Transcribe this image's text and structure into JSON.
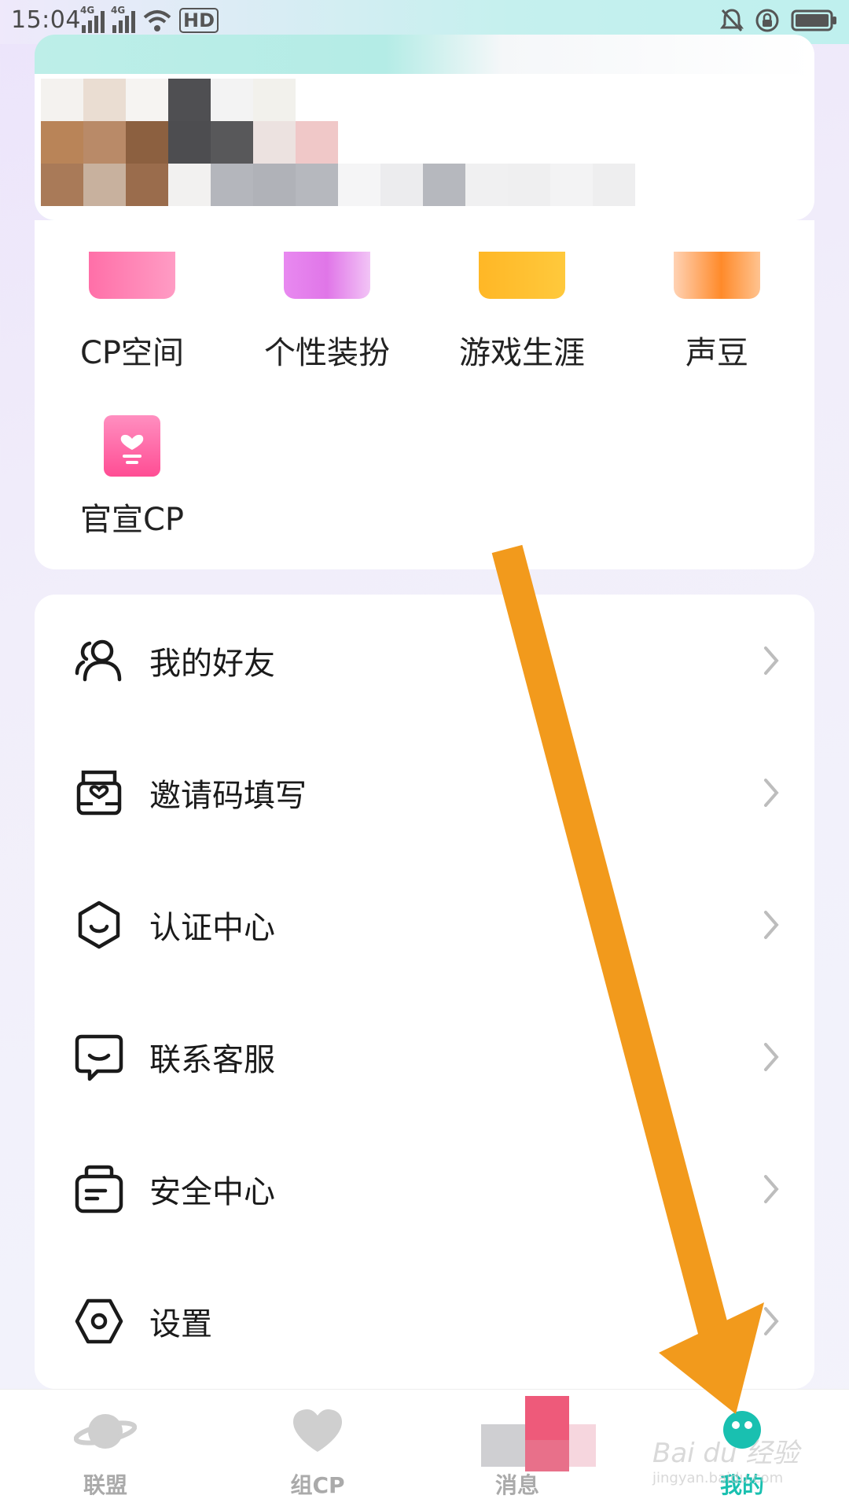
{
  "status_bar": {
    "time": "15:04",
    "network": [
      "4G",
      "4G"
    ],
    "hd": "HD"
  },
  "features": [
    {
      "label": "CP空间",
      "icon": "cp-space-icon"
    },
    {
      "label": "个性装扮",
      "icon": "dress-up-icon"
    },
    {
      "label": "游戏生涯",
      "icon": "game-career-icon"
    },
    {
      "label": "声豆",
      "icon": "voice-bean-icon"
    },
    {
      "label": "官宣CP",
      "icon": "announce-cp-icon"
    }
  ],
  "menu": [
    {
      "label": "我的好友",
      "icon": "friends-icon"
    },
    {
      "label": "邀请码填写",
      "icon": "invite-code-icon"
    },
    {
      "label": "认证中心",
      "icon": "verification-icon"
    },
    {
      "label": "联系客服",
      "icon": "customer-service-icon"
    },
    {
      "label": "安全中心",
      "icon": "security-icon"
    },
    {
      "label": "设置",
      "icon": "settings-icon"
    }
  ],
  "tabs": [
    {
      "label": "联盟",
      "icon": "planet-icon",
      "active": false
    },
    {
      "label": "组CP",
      "icon": "heart-icon",
      "active": false
    },
    {
      "label": "消息",
      "icon": "message-icon",
      "active": false
    },
    {
      "label": "我的",
      "icon": "profile-icon",
      "active": true
    }
  ],
  "colors": {
    "accent": "#19c0b0",
    "arrow": "#f29a1c"
  },
  "watermark": {
    "brand": "Bai du 经验",
    "url": "jingyan.baidu.com"
  }
}
